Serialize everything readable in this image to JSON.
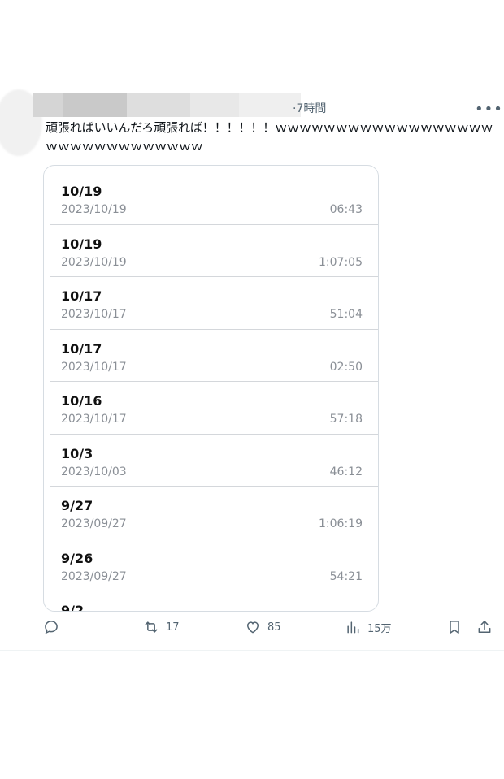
{
  "tweet": {
    "time": "·7時間",
    "text": "頑張ればいいんだろ頑張れば！！！！！！ｗｗｗｗｗｗｗｗｗｗｗｗｗｗｗｗｗｗｗｗｗｗｗｗｗｗｗｗｗｗｗ"
  },
  "list": [
    {
      "title": "10/19",
      "date": "2023/10/19",
      "duration": "06:43"
    },
    {
      "title": "10/19",
      "date": "2023/10/19",
      "duration": "1:07:05"
    },
    {
      "title": "10/17",
      "date": "2023/10/17",
      "duration": "51:04"
    },
    {
      "title": "10/17",
      "date": "2023/10/17",
      "duration": "02:50"
    },
    {
      "title": "10/16",
      "date": "2023/10/17",
      "duration": "57:18"
    },
    {
      "title": "10/3",
      "date": "2023/10/03",
      "duration": "46:12"
    },
    {
      "title": "9/27",
      "date": "2023/09/27",
      "duration": "1:06:19"
    },
    {
      "title": "9/26",
      "date": "2023/09/27",
      "duration": "54:21"
    },
    {
      "title": "9/2",
      "date": "",
      "duration": ""
    }
  ],
  "actions": {
    "reply_count": "",
    "retweet_count": "17",
    "like_count": "85",
    "view_count": "15万"
  },
  "icons": {
    "more": "more-icon",
    "reply": "reply-icon",
    "retweet": "retweet-icon",
    "like": "heart-icon",
    "views": "views-icon",
    "bookmark": "bookmark-icon",
    "share": "share-icon"
  }
}
